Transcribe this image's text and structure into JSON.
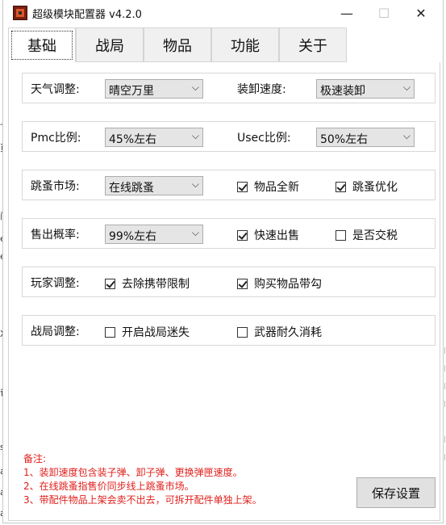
{
  "window": {
    "title": "超级模块配置器 v4.2.0",
    "controls": {
      "minimize": "—",
      "maximize": "☐",
      "close": "✕"
    }
  },
  "tabs": [
    {
      "label": "基础",
      "active": true
    },
    {
      "label": "战局",
      "active": false
    },
    {
      "label": "物品",
      "active": false
    },
    {
      "label": "功能",
      "active": false
    },
    {
      "label": "关于",
      "active": false
    }
  ],
  "rows": {
    "weather": {
      "label": "天气调整:",
      "value": "晴空万里"
    },
    "loading_speed": {
      "label": "装卸速度:",
      "value": "极速装卸"
    },
    "pmc_ratio": {
      "label": "Pmc比例:",
      "value": "45%左右"
    },
    "usec_ratio": {
      "label": "Usec比例:",
      "value": "50%左右"
    },
    "flea_market": {
      "label": "跳蚤市场:",
      "value": "在线跳蚤",
      "chk1": {
        "label": "物品全新",
        "checked": true
      },
      "chk2": {
        "label": "跳蚤优化",
        "checked": true
      }
    },
    "sell_chance": {
      "label": "售出概率:",
      "value": "99%左右",
      "chk1": {
        "label": "快速出售",
        "checked": true
      },
      "chk2": {
        "label": "是否交税",
        "checked": false
      }
    },
    "player": {
      "label": "玩家调整:",
      "chk1": {
        "label": "去除携带限制",
        "checked": true
      },
      "chk2": {
        "label": "购买物品带勾",
        "checked": true
      }
    },
    "raid": {
      "label": "战局调整:",
      "chk1": {
        "label": "开启战局迷失",
        "checked": false
      },
      "chk2": {
        "label": "武器耐久消耗",
        "checked": false
      }
    }
  },
  "notes": {
    "title": "备注:",
    "lines": [
      "1、装卸速度包含装子弹、卸子弹、更换弹匣速度。",
      "2、在线跳蚤指售价同步线上跳蚤市场。",
      "3、带配件物品上架会卖不出去，可拆开配件单独上架。"
    ]
  },
  "save_button": "保存设置",
  "colors": {
    "notes": "#e0201c",
    "combo_bg": "#e5e5e5",
    "button_bg": "#e1e1e1"
  }
}
